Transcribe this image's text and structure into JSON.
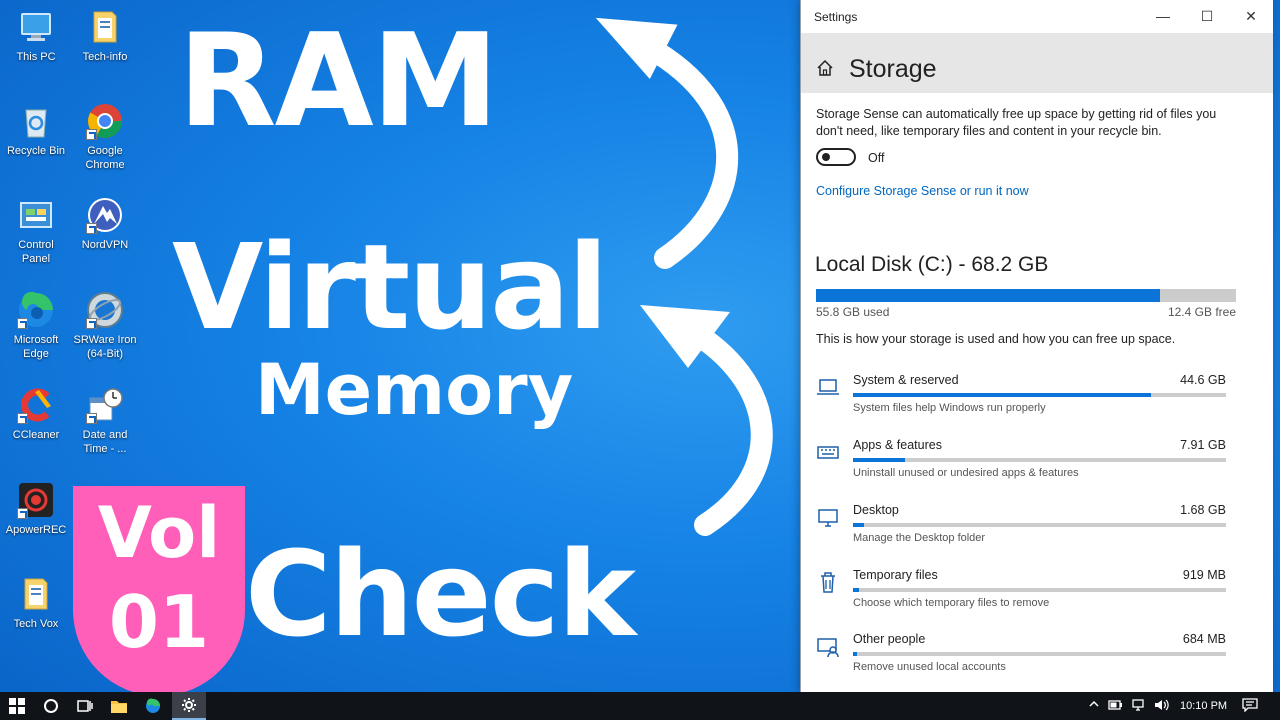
{
  "desktop_icons": [
    {
      "label": "This PC",
      "icon": "this-pc-icon"
    },
    {
      "label": "Tech-info",
      "icon": "folder-icon"
    },
    {
      "label": "Recycle Bin",
      "icon": "recycle-bin-icon"
    },
    {
      "label": "Google Chrome",
      "icon": "chrome-icon"
    },
    {
      "label": "Control Panel",
      "icon": "control-panel-icon"
    },
    {
      "label": "NordVPN",
      "icon": "nordvpn-icon"
    },
    {
      "label": "Microsoft Edge",
      "icon": "edge-icon"
    },
    {
      "label": "SRWare Iron (64-Bit)",
      "icon": "srware-iron-icon"
    },
    {
      "label": "CCleaner",
      "icon": "ccleaner-icon"
    },
    {
      "label": "Date and Time - ...",
      "icon": "date-time-icon"
    },
    {
      "label": "ApowerREC",
      "icon": "apowerrec-icon"
    },
    {
      "label": "Tech Vox",
      "icon": "folder-icon"
    }
  ],
  "overlay": {
    "ram": "RAM",
    "virtual": "Virtual",
    "memory": "Memory",
    "check": "Check",
    "vol": "Vol",
    "vol_number": "01",
    "badge_color": "#ff5fb8"
  },
  "window": {
    "title": "Settings",
    "minimize": "—",
    "maximize": "☐",
    "close": "✕",
    "page_title": "Storage",
    "storage_sense_desc": "Storage Sense can automatically free up space by getting rid of files you don't need, like temporary files and content in your recycle bin.",
    "toggle_state": "Off",
    "configure_link": "Configure Storage Sense or run it now",
    "disk": {
      "title": "Local Disk (C:) - 68.2 GB",
      "used_label": "55.8 GB used",
      "free_label": "12.4 GB free",
      "used_fraction": 0.818
    },
    "info_text": "This is how your storage is used and how you can free up space.",
    "categories": [
      {
        "name": "System & reserved",
        "size": "44.6 GB",
        "sub": "System files help Windows run properly",
        "fraction": 0.8,
        "icon": "laptop-icon"
      },
      {
        "name": "Apps & features",
        "size": "7.91 GB",
        "sub": "Uninstall unused or undesired apps & features",
        "fraction": 0.14,
        "icon": "keyboard-icon"
      },
      {
        "name": "Desktop",
        "size": "1.68 GB",
        "sub": "Manage the Desktop folder",
        "fraction": 0.03,
        "icon": "monitor-icon"
      },
      {
        "name": "Temporary files",
        "size": "919 MB",
        "sub": "Choose which temporary files to remove",
        "fraction": 0.015,
        "icon": "trash-icon"
      },
      {
        "name": "Other people",
        "size": "684 MB",
        "sub": "Remove unused local accounts",
        "fraction": 0.012,
        "icon": "people-icon"
      }
    ],
    "accent_color": "#0a74d8"
  },
  "taskbar": {
    "time": "10:10 PM"
  }
}
